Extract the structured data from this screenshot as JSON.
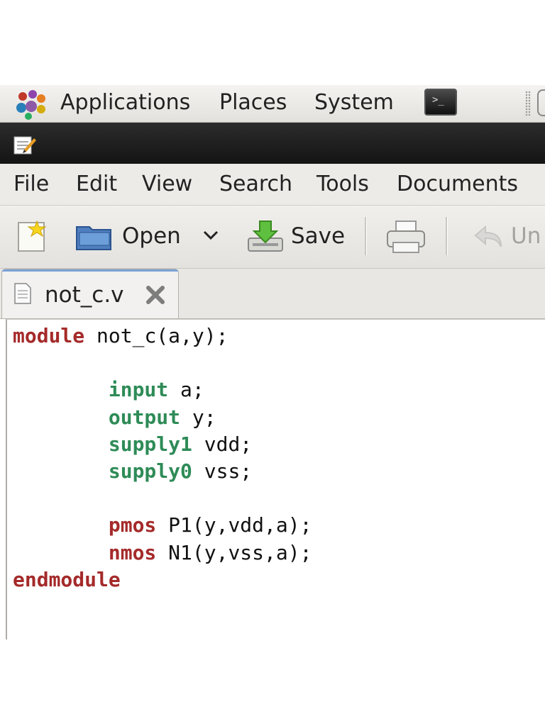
{
  "panel": {
    "menus": [
      "Applications",
      "Places",
      "System"
    ],
    "icons": [
      "gnome-foot-icon",
      "terminal-icon"
    ]
  },
  "menubar": {
    "items": [
      "File",
      "Edit",
      "View",
      "Search",
      "Tools",
      "Documents"
    ]
  },
  "toolbar": {
    "open_label": "Open",
    "save_label": "Save",
    "undo_label_partial": "Un"
  },
  "tab": {
    "filename": "not_c.v"
  },
  "editor": {
    "lines": [
      {
        "kw": "module",
        "rest": " not_c(a,y);",
        "kwclass": "red",
        "indent": ""
      },
      {
        "kw": "",
        "rest": "",
        "kwclass": "",
        "indent": ""
      },
      {
        "kw": "input",
        "rest": " a;",
        "kwclass": "green",
        "indent": "        "
      },
      {
        "kw": "output",
        "rest": " y;",
        "kwclass": "green",
        "indent": "        "
      },
      {
        "kw": "supply1",
        "rest": " vdd;",
        "kwclass": "green",
        "indent": "        "
      },
      {
        "kw": "supply0",
        "rest": " vss;",
        "kwclass": "green",
        "indent": "        "
      },
      {
        "kw": "",
        "rest": "",
        "kwclass": "",
        "indent": ""
      },
      {
        "kw": "pmos",
        "rest": " P1(y,vdd,a);",
        "kwclass": "red",
        "indent": "        "
      },
      {
        "kw": "nmos",
        "rest": " N1(y,vss,a);",
        "kwclass": "red",
        "indent": "        "
      },
      {
        "kw": "endmodule",
        "rest": "",
        "kwclass": "red",
        "indent": ""
      }
    ]
  },
  "colors": {
    "keyword_red": "#a52a2a",
    "keyword_green": "#2e8b57",
    "titlebar": "#1c1c1c"
  }
}
